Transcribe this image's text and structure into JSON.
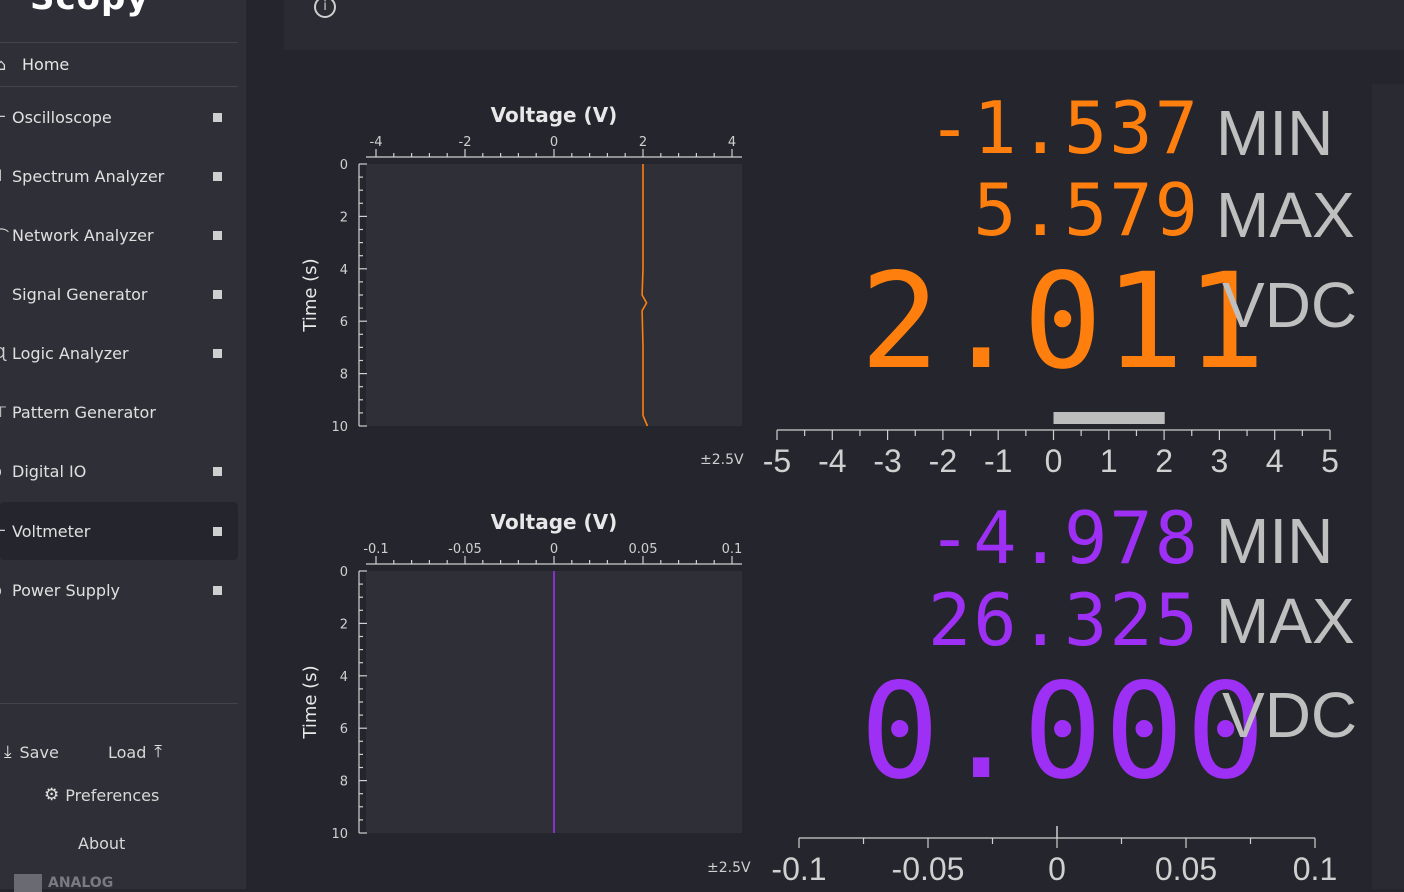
{
  "app": {
    "logo": "Scopy"
  },
  "sidebar": {
    "home": "Home",
    "items": [
      {
        "label": "Oscilloscope",
        "icon": "oscilloscope-icon"
      },
      {
        "label": "Spectrum Analyzer",
        "icon": "spectrum-icon"
      },
      {
        "label": "Network Analyzer",
        "icon": "network-icon"
      },
      {
        "label": "Signal Generator",
        "icon": "signal-icon"
      },
      {
        "label": "Logic Analyzer",
        "icon": "logic-icon"
      },
      {
        "label": "Pattern Generator",
        "icon": "pattern-icon"
      },
      {
        "label": "Digital IO",
        "icon": "digital-io-icon"
      },
      {
        "label": "Voltmeter",
        "icon": "voltmeter-icon"
      },
      {
        "label": "Power Supply",
        "icon": "power-icon"
      }
    ],
    "save": "Save",
    "load": "Load",
    "preferences": "Preferences",
    "about": "About",
    "brand": "ANALOG"
  },
  "colors": {
    "channel1": "#ff7f0e",
    "channel2": "#9e30f5"
  },
  "channels": [
    {
      "min": "-1.537",
      "max": "5.579",
      "value": "2.011",
      "min_label": "MIN",
      "max_label": "MAX",
      "unit": "VDC",
      "range": "±2.5V",
      "history_title": "Voltage (V)",
      "history_ylabel": "Time (s)",
      "history_xticks": [
        "-4",
        "-2",
        "0",
        "2",
        "4"
      ],
      "history_yticks": [
        "0",
        "2",
        "4",
        "6",
        "8",
        "10"
      ],
      "scale_ticks": [
        "-5",
        "-4",
        "-3",
        "-2",
        "-1",
        "0",
        "1",
        "2",
        "3",
        "4",
        "5"
      ]
    },
    {
      "min": "-4.978",
      "max": "26.325",
      "value": "0.000",
      "min_label": "MIN",
      "max_label": "MAX",
      "unit": "VDC",
      "range": "±2.5V",
      "history_title": "Voltage (V)",
      "history_ylabel": "Time (s)",
      "history_xticks": [
        "-0.1",
        "-0.05",
        "0",
        "0.05",
        "0.1"
      ],
      "history_yticks": [
        "0",
        "2",
        "4",
        "6",
        "8",
        "10"
      ],
      "scale_ticks": [
        "-0.1",
        "-0.05",
        "0",
        "0.05",
        "0.1"
      ]
    }
  ]
}
